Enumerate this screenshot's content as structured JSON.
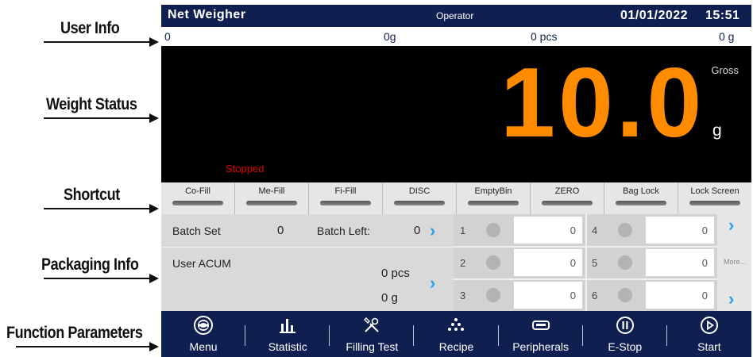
{
  "annotations": {
    "user_info": "User Info",
    "weight_status": "Weight Status",
    "shortcut": "Shortcut",
    "packaging_info": "Packaging Info",
    "function_parameters": "Function Parameters"
  },
  "header": {
    "title": "Net Weigher",
    "role": "Operator",
    "date": "01/01/2022",
    "time": "15:51"
  },
  "user_info_bar": {
    "id": "0",
    "weight": "0g",
    "count": "0  pcs",
    "total": "0 g"
  },
  "weight_display": {
    "mode": "Gross",
    "value": "10.0",
    "unit": "g",
    "status": "Stopped",
    "colors": {
      "value": "#ff8c00",
      "status": "#e00000"
    }
  },
  "shortcuts": [
    {
      "label": "Co-Fill"
    },
    {
      "label": "Me-Fill"
    },
    {
      "label": "Fi-Fill"
    },
    {
      "label": "DISC"
    },
    {
      "label": "EmptyBin"
    },
    {
      "label": "ZERO"
    },
    {
      "label": "Bag Lock"
    },
    {
      "label": "Lock Screen"
    }
  ],
  "packaging": {
    "batch_set_label": "Batch Set",
    "batch_set_value": "0",
    "batch_left_label": "Batch Left:",
    "batch_left_value": "0",
    "user_acum_label": "User ACUM",
    "acum_pcs": "0  pcs",
    "acum_g": "0  g",
    "heads": [
      {
        "num": "1",
        "value": "0"
      },
      {
        "num": "2",
        "value": "0"
      },
      {
        "num": "3",
        "value": "0"
      },
      {
        "num": "4",
        "value": "0"
      },
      {
        "num": "5",
        "value": "0"
      },
      {
        "num": "6",
        "value": "0"
      }
    ],
    "more_label": "More..."
  },
  "function_bar": [
    {
      "label": "Menu",
      "icon": "menu-logo-icon"
    },
    {
      "label": "Statistic",
      "icon": "bar-chart-icon"
    },
    {
      "label": "Filling Test",
      "icon": "tools-icon"
    },
    {
      "label": "Recipe",
      "icon": "recipe-dots-icon"
    },
    {
      "label": "Peripherals",
      "icon": "printer-icon"
    },
    {
      "label": "E-Stop",
      "icon": "pause-circle-icon"
    },
    {
      "label": "Start",
      "icon": "play-circle-icon"
    }
  ],
  "theme": {
    "navy": "#0f1f4f",
    "accent_blue": "#2aa0e6"
  }
}
